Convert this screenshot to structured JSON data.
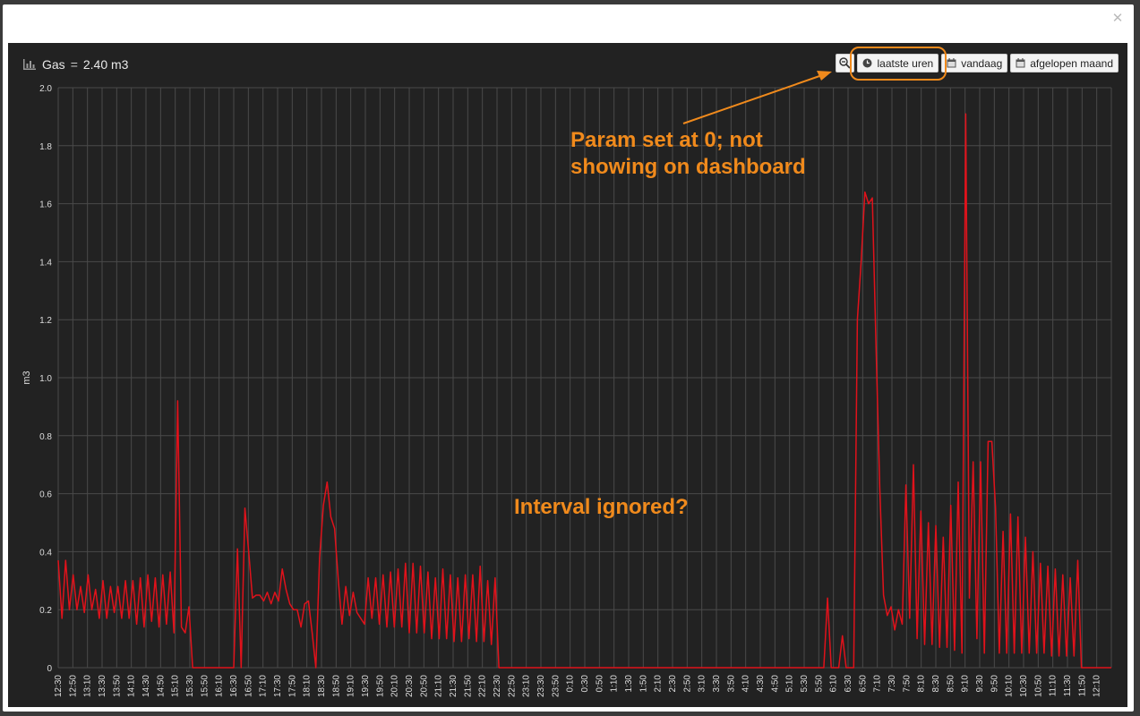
{
  "panel": {
    "title": "Gas",
    "equals": "=",
    "value": "2.40 m3"
  },
  "buttons": {
    "zoom_icon": "zoom-out-icon",
    "recent_hours": "laatste uren",
    "today": "vandaag",
    "last_month": "afgelopen maand"
  },
  "annotations": {
    "param_line1": "Param set at 0; not",
    "param_line2": "showing on dashboard",
    "interval": "Interval ignored?"
  },
  "colors": {
    "line": "#e0121b",
    "annotation": "#f08a1c",
    "panel_bg": "#222222",
    "grid": "#4a4a4a"
  },
  "chart_data": {
    "type": "line",
    "ylabel": "m3",
    "ylim": [
      0,
      2.0
    ],
    "yticks": [
      "0",
      "0.2",
      "0.4",
      "0.6",
      "0.8",
      "1.0",
      "1.2",
      "1.4",
      "1.6",
      "1.8",
      "2.0"
    ],
    "xtick_labels": [
      "12:30",
      "12:50",
      "13:10",
      "13:30",
      "13:50",
      "14:10",
      "14:30",
      "14:50",
      "15:10",
      "15:30",
      "15:50",
      "16:10",
      "16:30",
      "16:50",
      "17:10",
      "17:30",
      "17:50",
      "18:10",
      "18:30",
      "18:50",
      "19:10",
      "19:30",
      "19:50",
      "20:10",
      "20:30",
      "20:50",
      "21:10",
      "21:30",
      "21:50",
      "22:10",
      "22:30",
      "22:50",
      "23:10",
      "23:30",
      "23:50",
      "0:10",
      "0:30",
      "0:50",
      "1:10",
      "1:30",
      "1:50",
      "2:10",
      "2:30",
      "2:50",
      "3:10",
      "3:30",
      "3:50",
      "4:10",
      "4:30",
      "4:50",
      "5:10",
      "5:30",
      "5:50",
      "6:10",
      "6:30",
      "6:50",
      "7:10",
      "7:30",
      "7:50",
      "8:10",
      "8:30",
      "8:50",
      "9:10",
      "9:30",
      "9:50",
      "10:10",
      "10:30",
      "10:50",
      "11:10",
      "11:30",
      "11:50",
      "12:10"
    ],
    "series": [
      {
        "values": [
          0.37,
          0.17,
          0.37,
          0.2,
          0.32,
          0.2,
          0.28,
          0.19,
          0.32,
          0.2,
          0.27,
          0.17,
          0.3,
          0.17,
          0.28,
          0.19,
          0.28,
          0.17,
          0.3,
          0.17,
          0.3,
          0.15,
          0.31,
          0.14,
          0.32,
          0.16,
          0.31,
          0.14,
          0.32,
          0.15,
          0.33,
          0.12,
          0.92,
          0.14,
          0.12,
          0.21,
          0,
          0,
          0,
          0,
          0,
          0,
          0,
          0,
          0,
          0,
          0,
          0,
          0.41,
          0,
          0.55,
          0.4,
          0.24,
          0.25,
          0.25,
          0.23,
          0.26,
          0.22,
          0.26,
          0.23,
          0.34,
          0.27,
          0.22,
          0.2,
          0.2,
          0.14,
          0.22,
          0.23,
          0.12,
          0,
          0.38,
          0.56,
          0.64,
          0.52,
          0.48,
          0.3,
          0.15,
          0.28,
          0.18,
          0.26,
          0.19,
          0.17,
          0.15,
          0.31,
          0.17,
          0.31,
          0.15,
          0.32,
          0.14,
          0.33,
          0.14,
          0.34,
          0.14,
          0.36,
          0.12,
          0.36,
          0.12,
          0.35,
          0.12,
          0.33,
          0.1,
          0.31,
          0.1,
          0.34,
          0.1,
          0.32,
          0.09,
          0.31,
          0.09,
          0.32,
          0.1,
          0.32,
          0.09,
          0.35,
          0.09,
          0.3,
          0.08,
          0.31,
          0,
          0,
          0,
          0,
          0,
          0,
          0,
          0,
          0,
          0,
          0,
          0,
          0,
          0,
          0,
          0,
          0,
          0,
          0,
          0,
          0,
          0,
          0,
          0,
          0,
          0,
          0,
          0,
          0,
          0,
          0,
          0,
          0,
          0,
          0,
          0,
          0,
          0,
          0,
          0,
          0,
          0,
          0,
          0,
          0,
          0,
          0,
          0,
          0,
          0,
          0,
          0,
          0,
          0,
          0,
          0,
          0,
          0,
          0,
          0,
          0,
          0,
          0,
          0,
          0,
          0,
          0,
          0,
          0,
          0,
          0,
          0,
          0,
          0,
          0,
          0,
          0,
          0,
          0,
          0,
          0,
          0,
          0,
          0,
          0,
          0,
          0,
          0,
          0.24,
          0,
          0,
          0,
          0.11,
          0,
          0,
          0,
          1.2,
          1.4,
          1.64,
          1.6,
          1.62,
          1.1,
          0.62,
          0.25,
          0.18,
          0.21,
          0.13,
          0.2,
          0.15,
          0.63,
          0.17,
          0.7,
          0.1,
          0.54,
          0.08,
          0.5,
          0.08,
          0.49,
          0.07,
          0.45,
          0.07,
          0.56,
          0.06,
          0.64,
          0.05,
          1.91,
          0.24,
          0.71,
          0.1,
          0.71,
          0.05,
          0.78,
          0.78,
          0.55,
          0.05,
          0.47,
          0.05,
          0.53,
          0.05,
          0.52,
          0.05,
          0.45,
          0.05,
          0.4,
          0.05,
          0.36,
          0.05,
          0.35,
          0.04,
          0.34,
          0.04,
          0.32,
          0.04,
          0.31,
          0.04,
          0.37,
          0,
          0,
          0,
          0,
          0,
          0,
          0,
          0,
          0
        ]
      }
    ]
  }
}
